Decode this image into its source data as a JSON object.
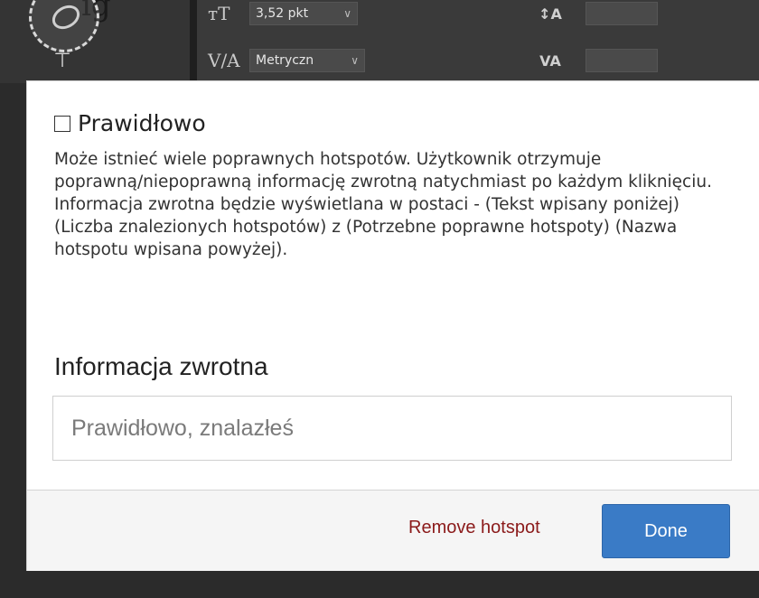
{
  "background": {
    "top_partial_text": "ig",
    "font_size_field": "3,52 pkt",
    "kerning_field": "Metryczn",
    "right_icon_top": "↕A",
    "right_icon_bottom": "VA"
  },
  "panel": {
    "correct_label": "Prawidłowo",
    "description": "Może istnieć wiele poprawnych hotspotów. Użytkownik otrzymuje poprawną/niepoprawną informację zwrotną natychmiast po każdym kliknięciu. Informacja zwrotna będzie wyświetlana w postaci - (Tekst wpisany poniżej) (Liczba znalezionych hotspotów) z (Potrzebne poprawne hotspoty) (Nazwa hotspotu wpisana powyżej).",
    "feedback_heading": "Informacja zwrotna",
    "feedback_placeholder": "Prawidłowo, znalazłeś",
    "remove_label": "Remove hotspot",
    "done_label": "Done"
  },
  "colors": {
    "done_button": "#3a7bc6",
    "remove_link": "#8b1a1a"
  }
}
